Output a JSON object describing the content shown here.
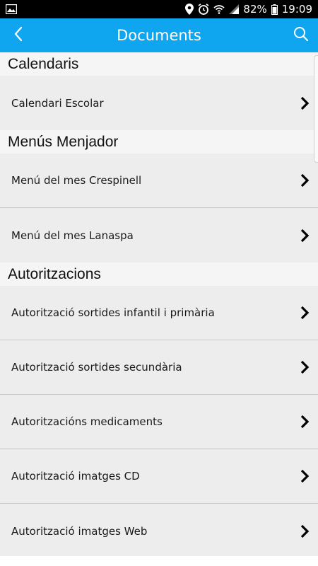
{
  "status": {
    "battery": "82%",
    "time": "19:09"
  },
  "header": {
    "title": "Documents"
  },
  "sections": [
    {
      "title": "Calendaris",
      "items": [
        "Calendari Escolar"
      ]
    },
    {
      "title": "Menús Menjador",
      "items": [
        "Menú del mes Crespinell",
        "Menú del mes Lanaspa"
      ]
    },
    {
      "title": "Autoritzacions",
      "items": [
        "Autorització sortides infantil i primària",
        "Autorització sortides secundària",
        "Autoritzacións medicaments",
        "Autorització imatges CD",
        "Autorització imatges Web"
      ]
    }
  ],
  "colors": {
    "app_bar": "#10a6ef",
    "row_bg": "#ededed",
    "section_bg": "#f5f5f5"
  }
}
